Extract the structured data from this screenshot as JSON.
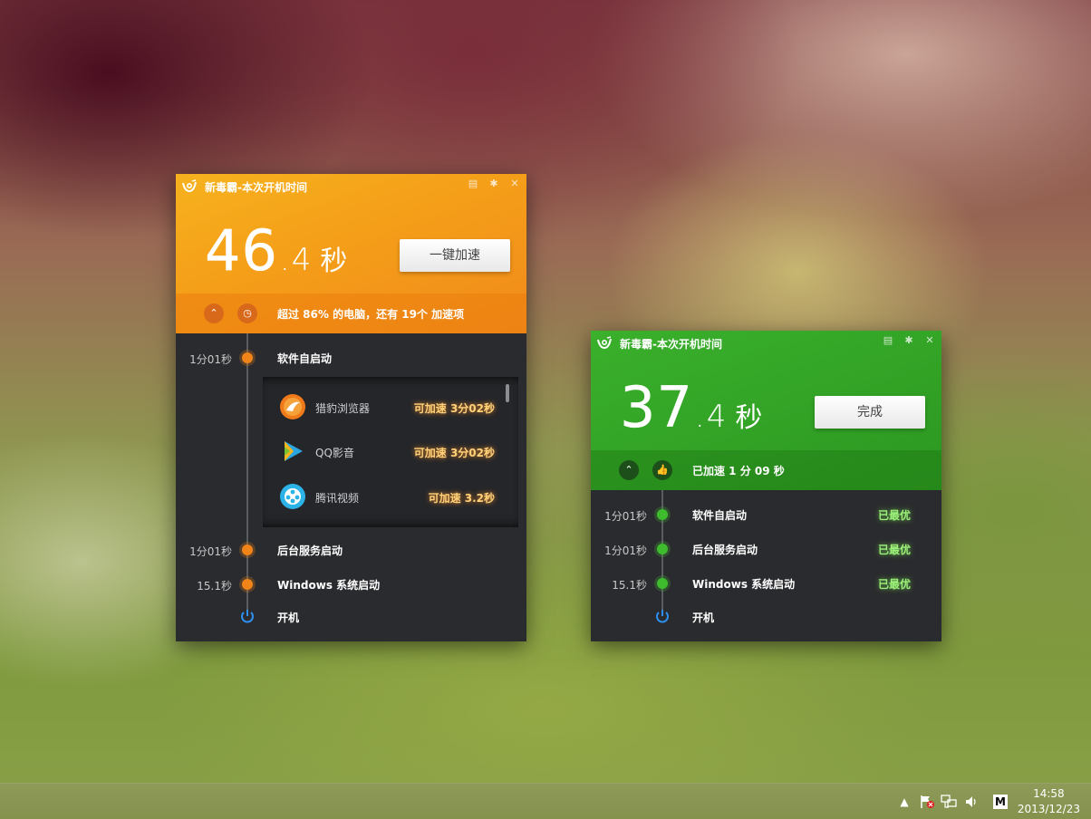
{
  "windows": [
    {
      "id": "orange",
      "title": "新毒霸-本次开机时间",
      "time_int": "46",
      "time_dot": ".",
      "time_dec": "4",
      "time_unit": "秒",
      "action_label": "一键加速",
      "summary": "超过 86% 的电脑，还有 19个 加速项",
      "rows": [
        {
          "time": "1分01秒",
          "label": "软件自启动"
        },
        {
          "time": "1分01秒",
          "label": "后台服务启动"
        },
        {
          "time": "15.1秒",
          "label": "Windows 系统启动"
        },
        {
          "time": "",
          "label": "开机"
        }
      ],
      "subitems": [
        {
          "name": "猎豹浏览器",
          "gain": "可加速 3分02秒",
          "icon": "liebao-browser-icon"
        },
        {
          "name": "QQ影音",
          "gain": "可加速 3分02秒",
          "icon": "qq-player-icon"
        },
        {
          "name": "腾讯视频",
          "gain": "可加速 3.2秒",
          "icon": "tencent-video-icon"
        }
      ]
    },
    {
      "id": "green",
      "title": "新毒霸-本次开机时间",
      "time_int": "37",
      "time_dot": ".",
      "time_dec": "4",
      "time_unit": "秒",
      "action_label": "完成",
      "summary": "已加速 1 分 09 秒",
      "rows": [
        {
          "time": "1分01秒",
          "label": "软件自启动",
          "status": "已最优"
        },
        {
          "time": "1分01秒",
          "label": "后台服务启动",
          "status": "已最优"
        },
        {
          "time": "15.1秒",
          "label": "Windows 系统启动",
          "status": "已最优"
        },
        {
          "time": "",
          "label": "开机"
        }
      ]
    }
  ],
  "colors": {
    "orange_accent": "#f08418",
    "green_accent": "#3fbb2e",
    "power_blue": "#2f8ff0"
  },
  "taskbar": {
    "clock_time": "14:58",
    "clock_date": "2013/12/23",
    "ime_label": "M"
  }
}
